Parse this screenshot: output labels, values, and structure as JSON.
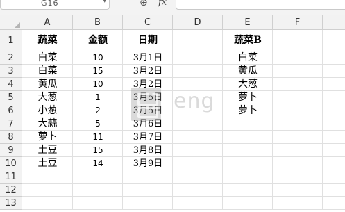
{
  "name_box": {
    "value": "G16"
  },
  "formula_bar": {
    "fx_label": "fx",
    "value": ""
  },
  "columns": [
    "A",
    "B",
    "C",
    "D",
    "E",
    "F"
  ],
  "rows": [
    "1",
    "2",
    "3",
    "4",
    "5",
    "6",
    "7",
    "8",
    "9",
    "10",
    "11",
    "12",
    "13"
  ],
  "headers": {
    "a1": "蔬菜",
    "b1": "金额",
    "c1": "日期",
    "e1": "蔬菜B"
  },
  "table": [
    {
      "veg": "白菜",
      "amount": "10",
      "date": "3月1日"
    },
    {
      "veg": "白菜",
      "amount": "15",
      "date": "3月2日"
    },
    {
      "veg": "黄瓜",
      "amount": "10",
      "date": "3月2日"
    },
    {
      "veg": "大葱",
      "amount": "1",
      "date": "3月5日"
    },
    {
      "veg": "小葱",
      "amount": "2",
      "date": "3月5日"
    },
    {
      "veg": "大蒜",
      "amount": "5",
      "date": "3月6日"
    },
    {
      "veg": "萝卜",
      "amount": "11",
      "date": "3月7日"
    },
    {
      "veg": "土豆",
      "amount": "15",
      "date": "3月8日"
    },
    {
      "veg": "土豆",
      "amount": "14",
      "date": "3月9日"
    }
  ],
  "veg_b": [
    "白菜",
    "黄瓜",
    "大葱",
    "萝卜",
    "萝卜"
  ],
  "watermark_text": "eng"
}
